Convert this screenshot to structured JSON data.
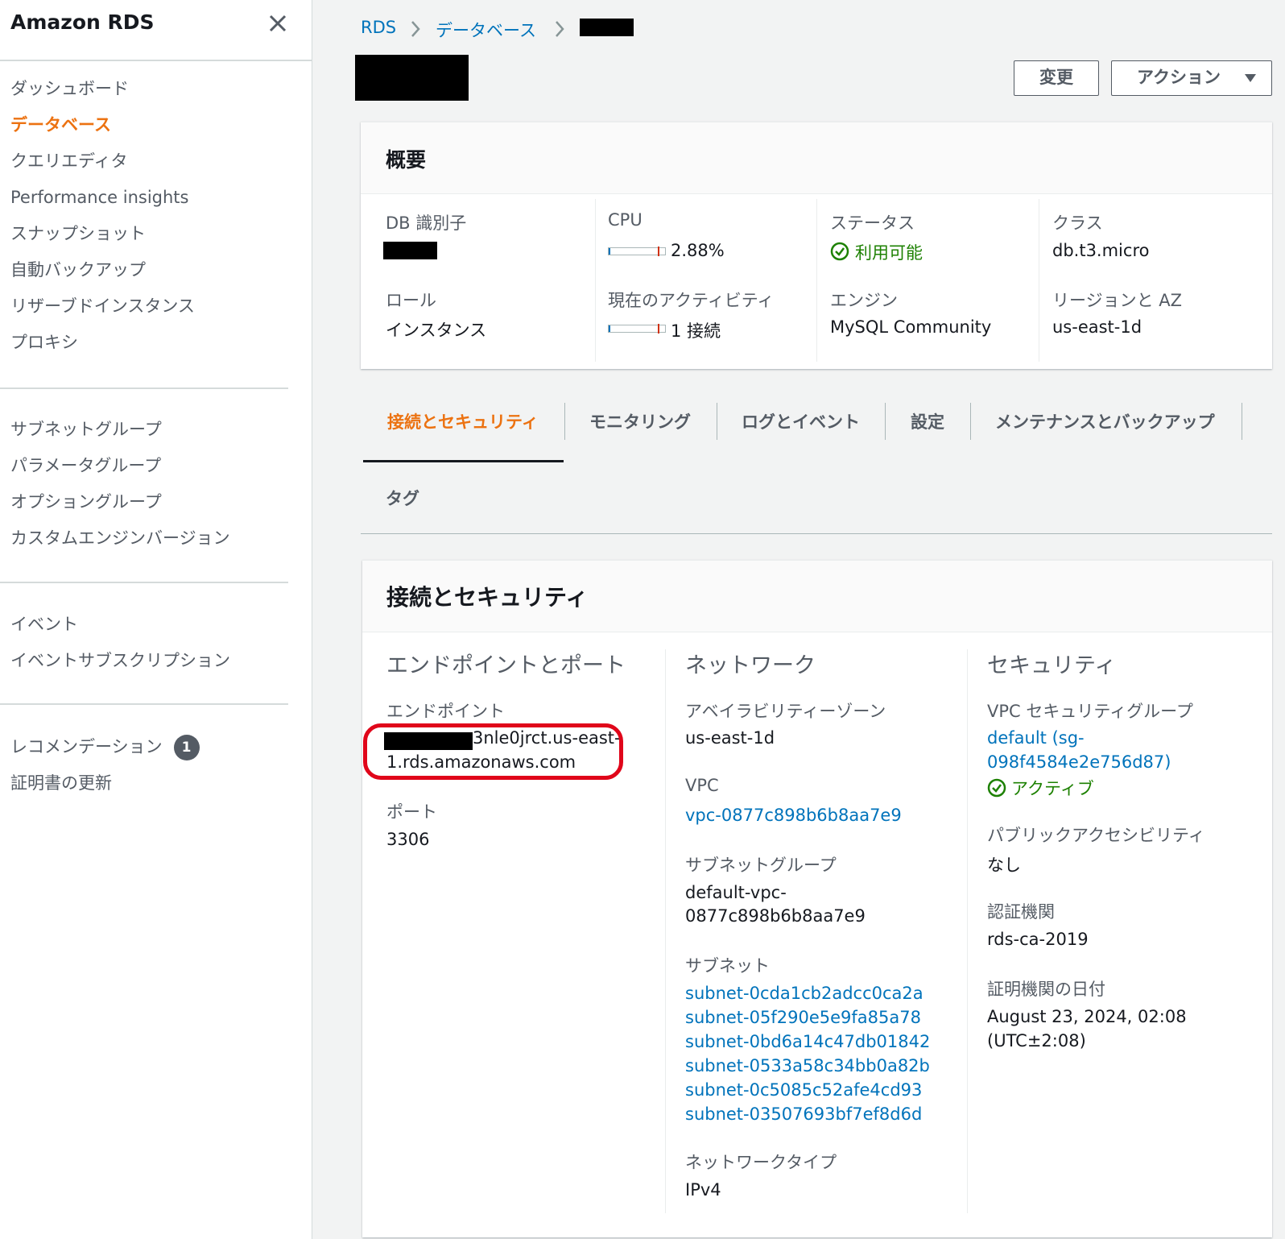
{
  "sidebar": {
    "title": "Amazon RDS",
    "group1": [
      "ダッシュボード",
      "データベース",
      "クエリエディタ",
      "Performance insights",
      "スナップショット",
      "自動バックアップ",
      "リザーブドインスタンス",
      "プロキシ"
    ],
    "group2": [
      "サブネットグループ",
      "パラメータグループ",
      "オプショングループ",
      "カスタムエンジンバージョン"
    ],
    "group3": [
      "イベント",
      "イベントサブスクリプション"
    ],
    "group4": [
      "レコメンデーション",
      "証明書の更新"
    ],
    "recommendation_badge": "1"
  },
  "breadcrumb": {
    "rds": "RDS",
    "databases": "データベース"
  },
  "actions": {
    "modify": "変更",
    "action": "アクション"
  },
  "summary": {
    "title": "概要",
    "db_identifier_label": "DB 識別子",
    "role_label": "ロール",
    "role_value": "インスタンス",
    "cpu_label": "CPU",
    "cpu_value": "2.88%",
    "cpu_percent": 2.88,
    "activity_label": "現在のアクティビティ",
    "activity_value": "1 接続",
    "status_label": "ステータス",
    "status_value": "利用可能",
    "engine_label": "エンジン",
    "engine_value": "MySQL Community",
    "class_label": "クラス",
    "class_value": "db.t3.micro",
    "region_label": "リージョンと AZ",
    "region_value": "us-east-1d"
  },
  "tabs": [
    "接続とセキュリティ",
    "モニタリング",
    "ログとイベント",
    "設定",
    "メンテナンスとバックアップ",
    "タグ"
  ],
  "connectivity": {
    "title": "接続とセキュリティ",
    "endpoint_heading": "エンドポイントとポート",
    "endpoint_label": "エンドポイント",
    "endpoint_line1": "3nle0jrct.us-east-",
    "endpoint_line2": "1.rds.amazonaws.com",
    "port_label": "ポート",
    "port_value": "3306",
    "network_heading": "ネットワーク",
    "az_label": "アベイラビリティーゾーン",
    "az_value": "us-east-1d",
    "vpc_label": "VPC",
    "vpc_value": "vpc-0877c898b6b8aa7e9",
    "subnet_group_label": "サブネットグループ",
    "subnet_group_line1": "default-vpc-",
    "subnet_group_line2": "0877c898b6b8aa7e9",
    "subnets_label": "サブネット",
    "subnets": [
      "subnet-0cda1cb2adcc0ca2a",
      "subnet-05f290e5e9fa85a78",
      "subnet-0bd6a14c47db01842",
      "subnet-0533a58c34bb0a82b",
      "subnet-0c5085c52afe4cd93",
      "subnet-03507693bf7ef8d6d"
    ],
    "network_type_label": "ネットワークタイプ",
    "network_type_value": "IPv4",
    "security_heading": "セキュリティ",
    "sg_label": "VPC セキュリティグループ",
    "sg_line1": "default (sg-",
    "sg_line2": "098f4584e2e756d87)",
    "sg_status": "アクティブ",
    "public_label": "パブリックアクセシビリティ",
    "public_value": "なし",
    "ca_label": "認証機関",
    "ca_value": "rds-ca-2019",
    "ca_date_label": "証明機関の日付",
    "ca_date_line1": "August 23, 2024, 02:08",
    "ca_date_line2": "(UTC±2:08)"
  },
  "colors": {
    "accent": "#ec7211",
    "link": "#0073bb",
    "success": "#1d8102",
    "highlight": "#e0061a"
  }
}
